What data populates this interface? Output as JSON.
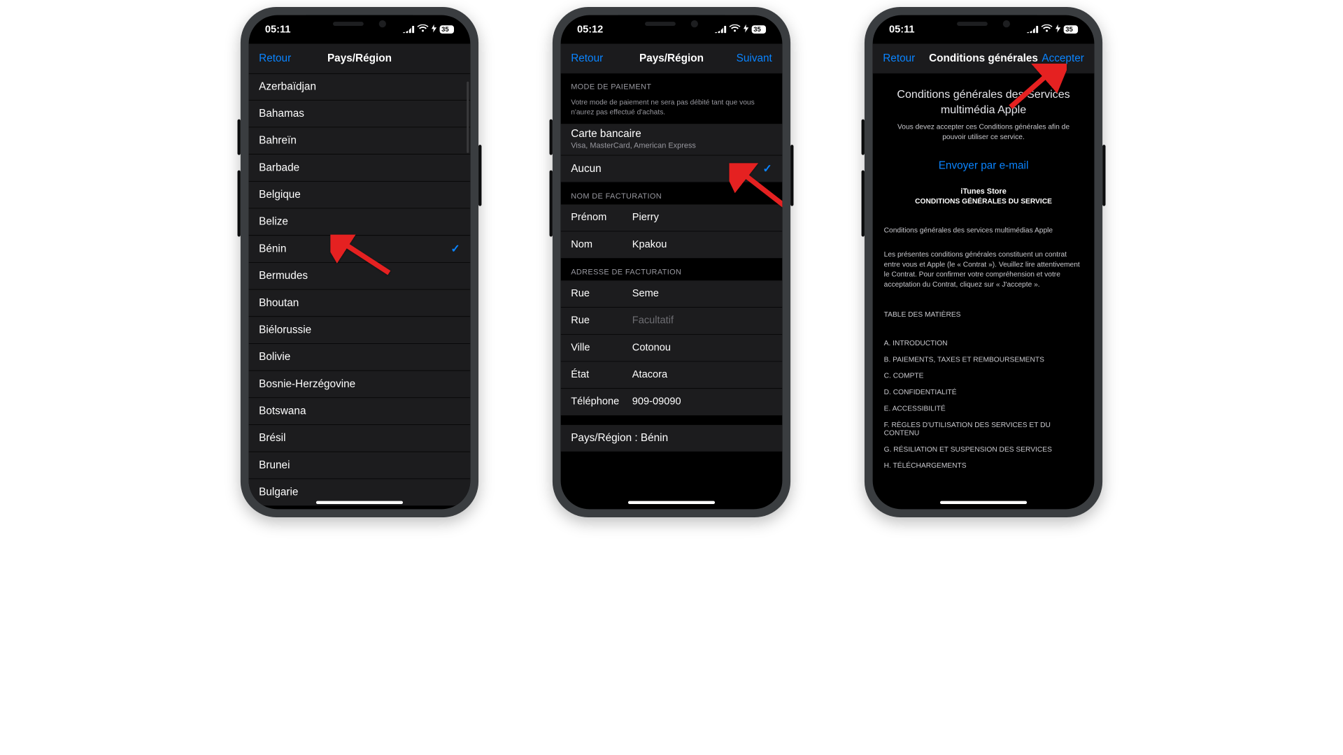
{
  "status": {
    "time1": "05:11",
    "time2": "05:12",
    "time3": "05:11",
    "battery": "35"
  },
  "screen1": {
    "nav": {
      "back": "Retour",
      "title": "Pays/Région"
    },
    "countries": [
      {
        "name": "Azerbaïdjan",
        "selected": false
      },
      {
        "name": "Bahamas",
        "selected": false
      },
      {
        "name": "Bahreïn",
        "selected": false
      },
      {
        "name": "Barbade",
        "selected": false
      },
      {
        "name": "Belgique",
        "selected": false
      },
      {
        "name": "Belize",
        "selected": false
      },
      {
        "name": "Bénin",
        "selected": true
      },
      {
        "name": "Bermudes",
        "selected": false
      },
      {
        "name": "Bhoutan",
        "selected": false
      },
      {
        "name": "Biélorussie",
        "selected": false
      },
      {
        "name": "Bolivie",
        "selected": false
      },
      {
        "name": "Bosnie-Herzégovine",
        "selected": false
      },
      {
        "name": "Botswana",
        "selected": false
      },
      {
        "name": "Brésil",
        "selected": false
      },
      {
        "name": "Brunei",
        "selected": false
      },
      {
        "name": "Bulgarie",
        "selected": false
      }
    ]
  },
  "screen2": {
    "nav": {
      "back": "Retour",
      "title": "Pays/Région",
      "next": "Suivant"
    },
    "payment": {
      "header": "MODE DE PAIEMENT",
      "note": "Votre mode de paiement ne sera pas débité tant que vous n'aurez pas effectué d'achats.",
      "card_title": "Carte bancaire",
      "card_detail": "Visa, MasterCard, American Express",
      "none": "Aucun"
    },
    "billing_name": {
      "header": "NOM DE FACTURATION",
      "first_label": "Prénom",
      "first_value": "Pierry",
      "last_label": "Nom",
      "last_value": "Kpakou"
    },
    "billing_addr": {
      "header": "ADRESSE DE FACTURATION",
      "street_label": "Rue",
      "street_value": "Seme",
      "street2_label": "Rue",
      "street2_placeholder": "Facultatif",
      "city_label": "Ville",
      "city_value": "Cotonou",
      "state_label": "État",
      "state_value": "Atacora",
      "phone_label": "Téléphone",
      "phone_value": "909-09090"
    },
    "country_line": "Pays/Région : Bénin"
  },
  "screen3": {
    "nav": {
      "back": "Retour",
      "title": "Conditions générales",
      "accept": "Accepter"
    },
    "title": "Conditions générales des Services multimédia Apple",
    "note": "Vous devez accepter ces Conditions générales afin de pouvoir utiliser ce service.",
    "mail": "Envoyer par e-mail",
    "doc_h1": "iTunes Store",
    "doc_h2": "CONDITIONS GÉNÉRALES DU SERVICE",
    "doc_p1": "Conditions générales des services multimédias Apple",
    "doc_p2": "Les présentes conditions générales constituent un contrat entre vous et Apple (le « Contrat »). Veuillez lire attentivement le Contrat. Pour confirmer votre compréhension et votre acceptation du Contrat, cliquez sur « J'accepte ».",
    "toc_h": "TABLE DES MATIÈRES",
    "toc": [
      "A. INTRODUCTION",
      "B. PAIEMENTS, TAXES ET REMBOURSEMENTS",
      "C. COMPTE",
      "D. CONFIDENTIALITÉ",
      "E. ACCESSIBILITÉ",
      "F. RÈGLES D'UTILISATION DES SERVICES ET DU CONTENU",
      "G. RÉSILIATION ET SUSPENSION DES SERVICES",
      "H. TÉLÉCHARGEMENTS"
    ]
  }
}
